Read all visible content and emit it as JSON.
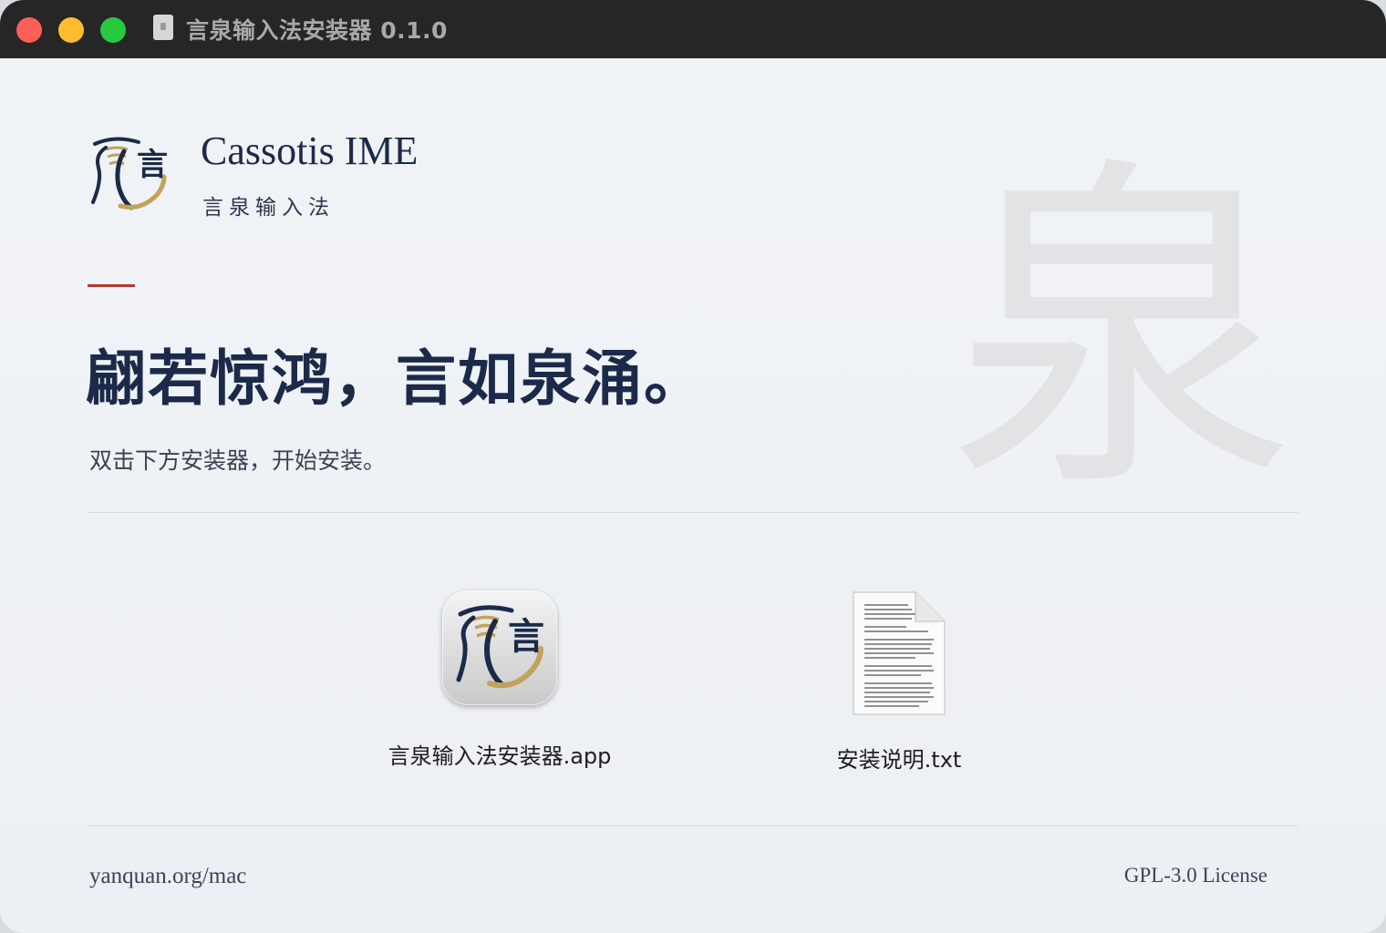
{
  "window": {
    "title": "言泉输入法安装器 0.1.0"
  },
  "brand": {
    "name": "Cassotis IME",
    "subtitle": "言泉输入法",
    "watermark_char": "泉",
    "logo_char": "言"
  },
  "hero": {
    "slogan": "翩若惊鸿，言如泉涌。",
    "instruction": "双击下方安装器，开始安装。"
  },
  "files": [
    {
      "label": "言泉输入法安装器.app",
      "icon": "app-icon"
    },
    {
      "label": "安装说明.txt",
      "icon": "text-document-icon"
    }
  ],
  "footer": {
    "link": "yanquan.org/mac",
    "license": "GPL-3.0 License"
  },
  "colors": {
    "accent": "#b13a2c",
    "brand_navy": "#1c2a4a",
    "gold": "#c2a25c",
    "titlebar": "#262626"
  }
}
